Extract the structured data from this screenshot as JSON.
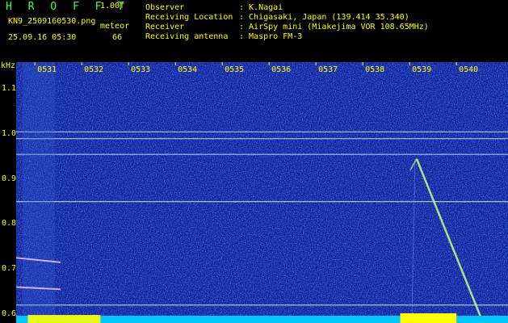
{
  "header": {
    "app_title": "H R O F F T",
    "version": "1.00f",
    "file_name": "KN9_2509160530.png",
    "meteor_label": "meteor",
    "timestamp": "25.09.16 05:30",
    "meteor_count": "66"
  },
  "station_info": [
    {
      "key": "Observer",
      "value": ": K.Nagai"
    },
    {
      "key": "Receiving Location",
      "value": ": Chigasaki, Japan (139.414 35.340)"
    },
    {
      "key": "Receiver",
      "value": ": AirSpy mini (Miakejima VOR 108.65MHz)"
    },
    {
      "key": "Receiving antenna",
      "value": ": Maspro FM-3"
    }
  ],
  "colors": {
    "background": "#0a1a9c",
    "label": "#ffff00",
    "title": "#3cff3c",
    "trace": "#d8f0ff",
    "bottom_bar": "#ffff00"
  },
  "chart_data": {
    "type": "heatmap",
    "ylabel": "kHz",
    "y_ticks": [
      "1.1",
      "1.0",
      "0.9",
      "0.8",
      "0.7",
      "0.6"
    ],
    "y_tick_values": [
      1.1,
      1.0,
      0.9,
      0.8,
      0.7,
      0.6
    ],
    "x_ticks": [
      "0531",
      "0532",
      "0533",
      "0534",
      "0535",
      "0536",
      "0537",
      "0538",
      "0539",
      "0540"
    ],
    "ylim": [
      0.58,
      1.16
    ],
    "xlim": [
      0,
      10.5
    ],
    "horizontal_lines_khz": [
      1.005,
      0.99,
      0.955,
      0.85,
      0.62
    ],
    "meteor_trace": {
      "x_start": 8.55,
      "y_start": 0.945,
      "x_end": 9.95,
      "y_end": 0.585
    }
  }
}
